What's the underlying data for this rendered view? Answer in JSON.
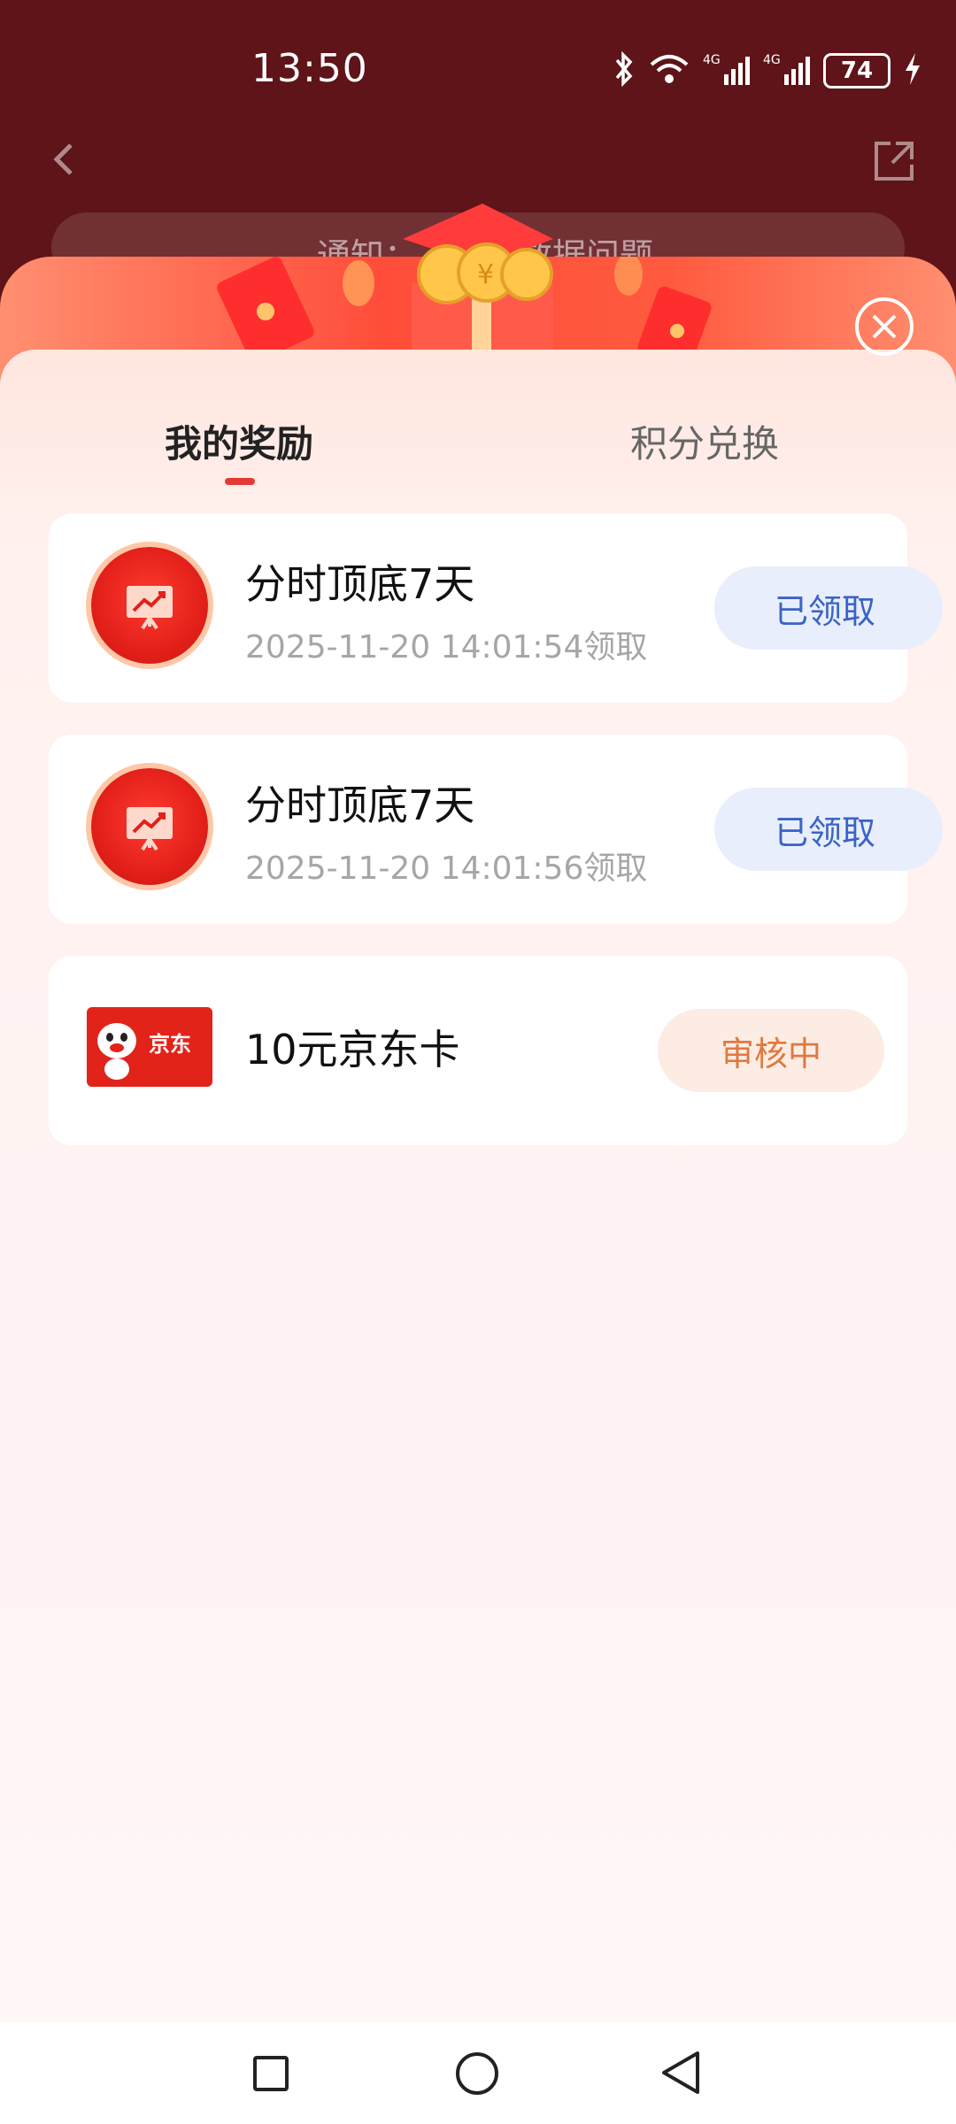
{
  "status": {
    "time": "13:50",
    "battery": "74"
  },
  "notice": {
    "text": "通知：……商数据问题"
  },
  "tabs": [
    {
      "label": "我的奖励"
    },
    {
      "label": "积分兑换"
    }
  ],
  "rewards": [
    {
      "title": "分时顶底7天",
      "subtitle": "2025-11-20 14:01:54领取",
      "action": "已领取"
    },
    {
      "title": "分时顶底7天",
      "subtitle": "2025-11-20 14:01:56领取",
      "action": "已领取"
    },
    {
      "title": "10元京东卡",
      "action": "审核中",
      "card_text": "京东"
    }
  ],
  "colors": {
    "accent_red": "#e53935",
    "claimed_blue": "#3a63c6",
    "review_orange": "#e0793e"
  }
}
